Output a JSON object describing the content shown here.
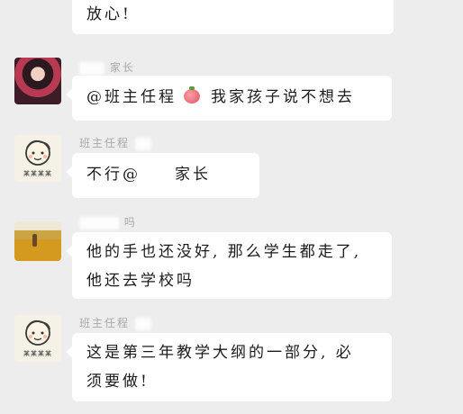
{
  "messages": [
    {
      "id": "m0",
      "sender_visible": "",
      "lines": [
        "放心!"
      ]
    },
    {
      "id": "m1",
      "sender_visible": "家长",
      "avatar": "girl-photo-avatar",
      "prefix": "@班主任程",
      "suffix": "我家孩子说不想去"
    },
    {
      "id": "m2",
      "sender_visible": "班主任程",
      "avatar": "cartoon-teacher-avatar",
      "avatar_caption": "某某某某",
      "prefix": "不行@",
      "suffix": "家长"
    },
    {
      "id": "m3",
      "sender_visible": "吗",
      "avatar": "field-photo-avatar",
      "lines": [
        "他的手也还没好, 那么学生都走了,",
        "他还去学校吗"
      ]
    },
    {
      "id": "m4",
      "sender_visible": "班主任程",
      "avatar": "cartoon-teacher-avatar",
      "avatar_caption": "某某某某",
      "lines": [
        "这是第三年教学大纲的一部分, 必",
        "须要做!"
      ]
    }
  ],
  "colors": {
    "background": "#ededed",
    "bubble": "#ffffff",
    "name_text": "#a9a9a9",
    "message_text": "#1b1b1b"
  }
}
